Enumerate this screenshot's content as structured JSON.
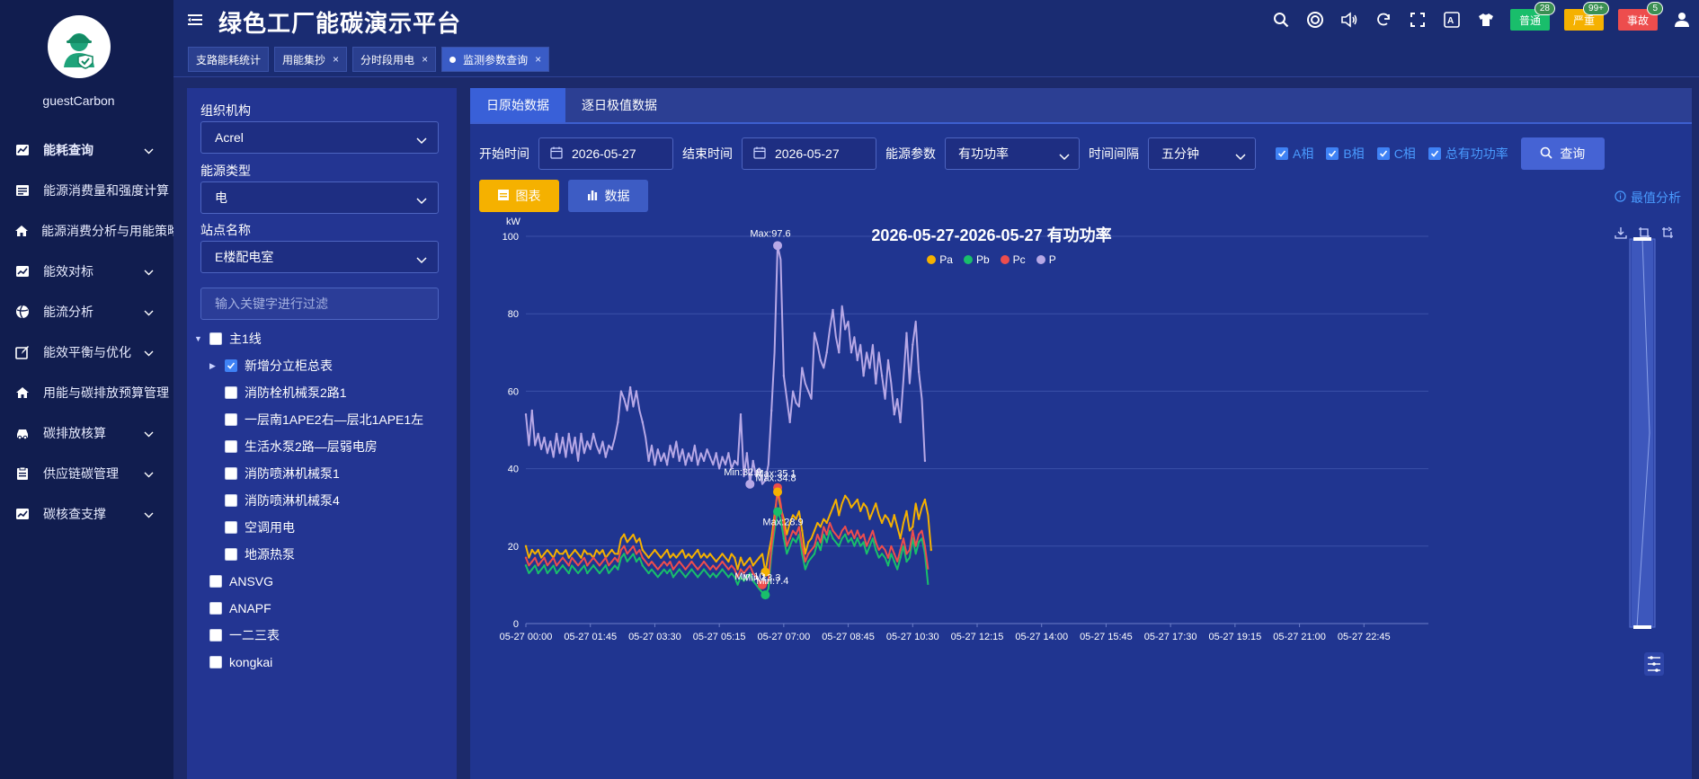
{
  "app": {
    "title": "绿色工厂能碳演示平台",
    "username": "guestCarbon"
  },
  "sidebar": {
    "items": [
      {
        "label": "能耗查询",
        "icon": "chart-icon",
        "chev": true,
        "bold": true
      },
      {
        "label": "能源消费量和强度计算",
        "icon": "table-icon",
        "chev": false
      },
      {
        "label": "能源消费分析与用能策略",
        "icon": "home-icon",
        "chev": false
      },
      {
        "label": "能效对标",
        "icon": "trend-icon",
        "chev": true
      },
      {
        "label": "能流分析",
        "icon": "flow-icon",
        "chev": true
      },
      {
        "label": "能效平衡与优化",
        "icon": "edit-icon",
        "chev": true
      },
      {
        "label": "用能与碳排放预算管理",
        "icon": "home-icon",
        "chev": false
      },
      {
        "label": "碳排放核算",
        "icon": "car-icon",
        "chev": true
      },
      {
        "label": "供应链碳管理",
        "icon": "clipboard-icon",
        "chev": true
      },
      {
        "label": "碳核查支撑",
        "icon": "trend-icon",
        "chev": true
      }
    ]
  },
  "header": {
    "tabs": [
      {
        "label": "支路能耗统计",
        "closable": false,
        "active": false
      },
      {
        "label": "用能集抄",
        "closable": true,
        "active": false
      },
      {
        "label": "分时段用电",
        "closable": true,
        "active": false
      },
      {
        "label": "监测参数查询",
        "closable": true,
        "active": true
      }
    ],
    "badges": [
      {
        "label": "普通",
        "count": "28",
        "color": "#19be6b"
      },
      {
        "label": "严重",
        "count": "99+",
        "color": "#f5b100"
      },
      {
        "label": "事故",
        "count": "5",
        "color": "#ed4d4d"
      }
    ]
  },
  "filters": {
    "org_label": "组织机构",
    "org_value": "Acrel",
    "energy_label": "能源类型",
    "energy_value": "电",
    "site_label": "站点名称",
    "site_value": "E楼配电室",
    "filter_placeholder": "输入关键字进行过滤"
  },
  "tree": [
    {
      "label": "主1线",
      "level": 0,
      "caret": "down",
      "checked": false
    },
    {
      "label": "新增分立柜总表",
      "level": 1,
      "caret": "right",
      "checked": true
    },
    {
      "label": "消防栓机械泵2路1",
      "level": 2,
      "caret": "",
      "checked": false
    },
    {
      "label": "一层南1APE2右—层北1APE1左",
      "level": 2,
      "caret": "",
      "checked": false
    },
    {
      "label": "生活水泵2路—层弱电房",
      "level": 2,
      "caret": "",
      "checked": false
    },
    {
      "label": "消防喷淋机械泵1",
      "level": 2,
      "caret": "",
      "checked": false
    },
    {
      "label": "消防喷淋机械泵4",
      "level": 2,
      "caret": "",
      "checked": false
    },
    {
      "label": "空调用电",
      "level": 2,
      "caret": "",
      "checked": false
    },
    {
      "label": "地源热泵",
      "level": 2,
      "caret": "",
      "checked": false
    },
    {
      "label": "ANSVG",
      "level": 0,
      "caret": "",
      "checked": false
    },
    {
      "label": "ANAPF",
      "level": 0,
      "caret": "",
      "checked": false
    },
    {
      "label": "一二三表",
      "level": 0,
      "caret": "",
      "checked": false
    },
    {
      "label": "kongkai",
      "level": 0,
      "caret": "",
      "checked": false
    }
  ],
  "main": {
    "tabs": [
      "日原始数据",
      "逐日极值数据"
    ],
    "start_label": "开始时间",
    "start_value": "2026-05-27",
    "end_label": "结束时间",
    "end_value": "2026-05-27",
    "param_label": "能源参数",
    "param_value": "有功功率",
    "interval_label": "时间间隔",
    "interval_value": "五分钟",
    "phases": [
      "A相",
      "B相",
      "C相",
      "总有功功率"
    ],
    "query_label": "查询",
    "chart_btn": "图表",
    "data_btn": "数据",
    "extreme_link": "最值分析"
  },
  "chart_data": {
    "type": "line",
    "title": "2026-05-27-2026-05-27  有功功率",
    "ylabel": "kW",
    "ylim": [
      0,
      100
    ],
    "yticks": [
      0,
      20,
      40,
      60,
      80,
      100
    ],
    "grid": true,
    "legend_position": "top-center",
    "xticks": [
      "05-27 00:00",
      "05-27 01:45",
      "05-27 03:30",
      "05-27 05:15",
      "05-27 07:00",
      "05-27 08:45",
      "05-27 10:30",
      "05-27 12:15",
      "05-27 14:00",
      "05-27 15:45",
      "05-27 17:30",
      "05-27 19:15",
      "05-27 21:00",
      "05-27 22:45"
    ],
    "series": [
      {
        "name": "Pa",
        "color": "#f5b100",
        "values": [
          20,
          17,
          19,
          18,
          19,
          17,
          18,
          19,
          18,
          17,
          19,
          18,
          18,
          19,
          17,
          18,
          19,
          18,
          17,
          19,
          18,
          18,
          17,
          19,
          18,
          19,
          17,
          18,
          19,
          18,
          18,
          22,
          23,
          21,
          22,
          23,
          21,
          22,
          19,
          18,
          17,
          18,
          19,
          18,
          17,
          18,
          19,
          17,
          18,
          17,
          18,
          19,
          17,
          18,
          17,
          18,
          19,
          17,
          18,
          17,
          18,
          17,
          16,
          17,
          18,
          17,
          16,
          18,
          17,
          14,
          17,
          15,
          16,
          17,
          15,
          16,
          17,
          18,
          13.3,
          18,
          22,
          28,
          34,
          30,
          27,
          23,
          26,
          28,
          27,
          29,
          24,
          18,
          21,
          22,
          24,
          26,
          25,
          27,
          26,
          28,
          30,
          32,
          28,
          31,
          33,
          32,
          30,
          31,
          32,
          29,
          31,
          30,
          27,
          29,
          31,
          28,
          26,
          28,
          27,
          25,
          28,
          25,
          22,
          26,
          29,
          24,
          25,
          31,
          27,
          30,
          32,
          28,
          19
        ]
      },
      {
        "name": "Pb",
        "color": "#19be6b",
        "values": [
          15,
          13,
          14,
          15,
          13,
          14,
          15,
          13,
          14,
          15,
          13,
          14,
          15,
          14,
          13,
          15,
          14,
          13,
          14,
          15,
          13,
          14,
          15,
          14,
          13,
          14,
          15,
          13,
          14,
          15,
          14,
          17,
          18,
          16,
          17,
          18,
          16,
          17,
          15,
          14,
          13,
          14,
          13,
          12,
          13,
          14,
          13,
          14,
          12,
          13,
          14,
          13,
          12,
          13,
          14,
          13,
          12,
          13,
          14,
          13,
          12,
          13,
          12,
          13,
          14,
          13,
          12,
          13,
          12,
          10,
          12,
          11,
          12,
          13,
          11,
          10,
          9,
          8,
          7.4,
          9,
          18,
          24,
          28.9,
          27,
          22,
          18,
          20,
          22,
          21,
          23,
          18,
          14,
          16,
          17,
          18,
          21,
          19,
          23,
          21,
          24,
          22,
          21,
          20,
          22,
          23,
          21,
          22,
          20,
          22,
          20,
          21,
          18,
          20,
          22,
          19,
          17,
          18,
          17,
          15,
          18,
          16,
          14,
          17,
          20,
          16,
          17,
          22,
          18,
          21,
          22,
          18,
          10
        ]
      },
      {
        "name": "Pc",
        "color": "#ed4d4d",
        "values": [
          17,
          15,
          16,
          17,
          15,
          16,
          17,
          15,
          16,
          17,
          15,
          16,
          17,
          16,
          15,
          17,
          16,
          15,
          16,
          17,
          15,
          16,
          17,
          16,
          15,
          16,
          17,
          15,
          16,
          17,
          16,
          19,
          20,
          18,
          19,
          20,
          18,
          19,
          17,
          16,
          15,
          16,
          15,
          14,
          15,
          16,
          15,
          16,
          14,
          15,
          16,
          15,
          14,
          15,
          16,
          15,
          14,
          15,
          16,
          15,
          14,
          15,
          14,
          15,
          16,
          15,
          14,
          15,
          14,
          12,
          14,
          13,
          14,
          15,
          13,
          12,
          11,
          10,
          10,
          11,
          20,
          26,
          35.1,
          31,
          25,
          20,
          22,
          24,
          23,
          25,
          20,
          16,
          18,
          19,
          20,
          23,
          21,
          25,
          23,
          26,
          24,
          23,
          22,
          24,
          25,
          23,
          24,
          22,
          24,
          22,
          23,
          20,
          22,
          24,
          21,
          19,
          20,
          19,
          17,
          20,
          18,
          16,
          19,
          22,
          18,
          19,
          24,
          20,
          23,
          24,
          20,
          14
        ]
      },
      {
        "name": "P",
        "color": "#b7a8e6",
        "values": [
          54,
          46,
          55,
          46,
          49,
          45,
          48,
          44,
          47,
          43,
          49,
          44,
          48,
          43,
          49,
          44,
          48,
          42,
          49,
          44,
          47,
          45,
          49,
          46,
          44,
          47,
          43,
          46,
          45,
          48,
          52,
          60,
          58,
          55,
          61,
          56,
          60,
          55,
          52,
          48,
          42,
          46,
          41,
          45,
          42,
          44,
          41,
          46,
          43,
          47,
          42,
          45,
          41,
          44,
          42,
          46,
          41,
          44,
          42,
          45,
          43,
          41,
          44,
          40,
          43,
          41,
          44,
          40,
          42,
          41,
          54,
          38,
          44,
          36,
          42,
          38,
          40,
          36,
          37,
          41,
          55,
          70,
          97.6,
          94,
          64,
          58,
          52,
          60,
          57,
          56,
          66,
          62,
          60,
          58,
          75,
          72,
          68,
          66,
          70,
          76,
          81,
          74,
          70,
          82,
          76,
          78,
          70,
          74,
          68,
          72,
          64,
          70,
          66,
          72,
          62,
          70,
          64,
          58,
          68,
          62,
          54,
          58,
          52,
          63,
          75,
          62,
          72,
          78,
          65,
          58,
          42
        ]
      }
    ],
    "annotations": [
      {
        "text": "Max:97.6",
        "series": "P",
        "index": 82
      },
      {
        "text": "Min:32.9",
        "series": "P",
        "index": 73
      },
      {
        "text": "Max:35.1",
        "series": "Pc",
        "index": 82
      },
      {
        "text": "Max:34.8",
        "series": "Pa",
        "index": 82
      },
      {
        "text": "Max:28.9",
        "series": "Pb",
        "index": 82
      },
      {
        "text": "Min:13.3",
        "series": "Pa",
        "index": 78
      },
      {
        "text": "Min:10",
        "series": "Pc",
        "index": 77
      },
      {
        "text": "Min:7.4",
        "series": "Pb",
        "index": 78
      }
    ]
  }
}
